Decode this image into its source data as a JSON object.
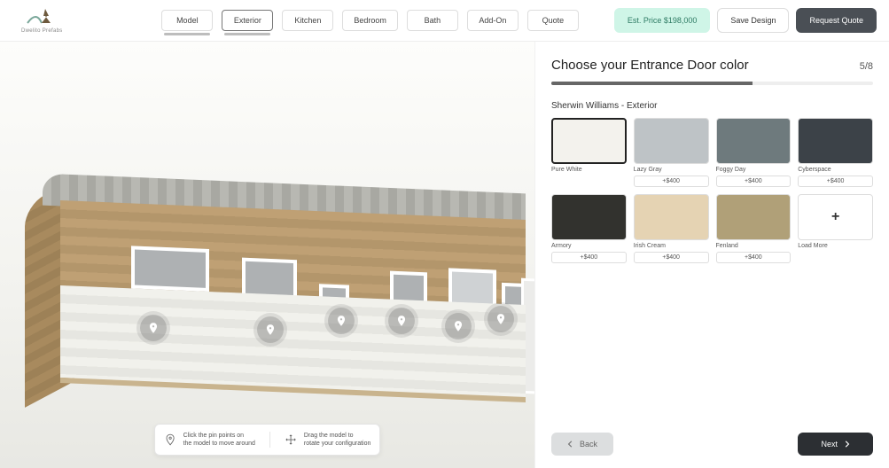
{
  "logo": {
    "subtitle": "Dwelito Prefabs"
  },
  "tabs": [
    {
      "label": "Model"
    },
    {
      "label": "Exterior"
    },
    {
      "label": "Kitchen"
    },
    {
      "label": "Bedroom"
    },
    {
      "label": "Bath"
    },
    {
      "label": "Add-On"
    },
    {
      "label": "Quote"
    }
  ],
  "header_actions": {
    "price": "Est. Price $198,000",
    "save": "Save Design",
    "quote": "Request Quote"
  },
  "viewer_hints": {
    "click": "Click the pin points on\nthe model to move around",
    "drag": "Drag the model to\nrotate your configuration"
  },
  "panel": {
    "title": "Choose your Entrance Door color",
    "step_current": "5",
    "step_total": "/8",
    "progress_percent": 62.5,
    "section": "Sherwin Williams - Exterior",
    "swatches": [
      {
        "name": "Pure White",
        "color": "#F3F2ED",
        "price": null,
        "selected": true
      },
      {
        "name": "Lazy Gray",
        "color": "#BEC3C6",
        "price": "+$400",
        "selected": false
      },
      {
        "name": "Foggy Day",
        "color": "#6E7A7D",
        "price": "+$400",
        "selected": false
      },
      {
        "name": "Cyberspace",
        "color": "#3C4248",
        "price": "+$400",
        "selected": false
      },
      {
        "name": "Armory",
        "color": "#32322E",
        "price": "+$400",
        "selected": false
      },
      {
        "name": "Irish Cream",
        "color": "#E5D3B3",
        "price": "+$400",
        "selected": false
      },
      {
        "name": "Fenland",
        "color": "#B0A078",
        "price": "+$400",
        "selected": false
      }
    ],
    "load_more": "Load More",
    "back": "Back",
    "next": "Next"
  }
}
